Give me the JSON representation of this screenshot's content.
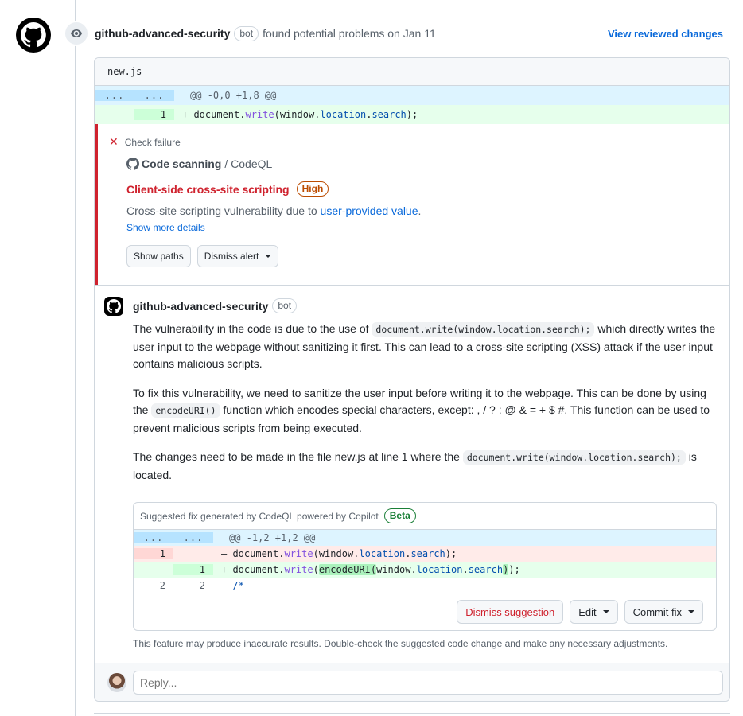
{
  "review": {
    "author": "github-advanced-security",
    "bot_label": "bot",
    "action_text": "found potential problems on Jan 11",
    "view_link": "View reviewed changes"
  },
  "file": {
    "name": "new.js",
    "hunk_header": "@@ -0,0 +1,8 @@",
    "dots": "...",
    "lines": [
      {
        "type": "add",
        "old": "",
        "new": "1",
        "sign": "+",
        "parts": [
          {
            "t": "document.",
            "c": ""
          },
          {
            "t": "write",
            "c": "fn"
          },
          {
            "t": "(window.",
            "c": ""
          },
          {
            "t": "location",
            "c": "prop"
          },
          {
            "t": ".",
            "c": ""
          },
          {
            "t": "search",
            "c": "prop"
          },
          {
            "t": ");",
            "c": ""
          }
        ]
      }
    ]
  },
  "alert": {
    "check_status": "Check failure",
    "scanner_name": "Code scanning",
    "scanner_tool": "/ CodeQL",
    "title": "Client-side cross-site scripting",
    "severity": "High",
    "description_prefix": "Cross-site scripting vulnerability due to ",
    "description_link": "user-provided value",
    "description_suffix": ".",
    "show_more": "Show more details",
    "show_paths_button": "Show paths",
    "dismiss_alert_button": "Dismiss alert"
  },
  "comment": {
    "author": "github-advanced-security",
    "bot_label": "bot",
    "p1_a": "The vulnerability in the code is due to the use of ",
    "p1_code": "document.write(window.location.search);",
    "p1_b": " which directly writes the user input to the webpage without sanitizing it first. This can lead to a cross-site scripting (XSS) attack if the user input contains malicious scripts.",
    "p2_a": "To fix this vulnerability, we need to sanitize the user input before writing it to the webpage. This can be done by using the ",
    "p2_code": "encodeURI()",
    "p2_b": " function which encodes special characters, except: , / ? : @ & = + $ #. This function can be used to prevent malicious scripts from being executed.",
    "p3_a": "The changes need to be made in the file new.js at line 1 where the ",
    "p3_code": "document.write(window.location.search);",
    "p3_b": " is located."
  },
  "suggestion": {
    "header": "Suggested fix generated by CodeQL powered by Copilot",
    "badge": "Beta",
    "hunk_header": "@@ -1,2 +1,2 @@",
    "dots": "...",
    "lines": [
      {
        "type": "del",
        "old": "1",
        "new": "",
        "sign": "–",
        "parts": [
          {
            "t": "document.",
            "c": ""
          },
          {
            "t": "write",
            "c": "fn"
          },
          {
            "t": "(window.",
            "c": ""
          },
          {
            "t": "location",
            "c": "prop"
          },
          {
            "t": ".",
            "c": ""
          },
          {
            "t": "search",
            "c": "prop"
          },
          {
            "t": ");",
            "c": ""
          }
        ]
      },
      {
        "type": "add",
        "old": "",
        "new": "1",
        "sign": "+",
        "parts": [
          {
            "t": "document.",
            "c": ""
          },
          {
            "t": "write",
            "c": "fn"
          },
          {
            "t": "(",
            "c": ""
          },
          {
            "t": "encodeURI(",
            "c": "hl"
          },
          {
            "t": "window.",
            "c": ""
          },
          {
            "t": "location",
            "c": "prop"
          },
          {
            "t": ".",
            "c": ""
          },
          {
            "t": "search",
            "c": "prop"
          },
          {
            "t": ")",
            "c": "hl"
          },
          {
            "t": ");",
            "c": ""
          }
        ]
      },
      {
        "type": "ctx",
        "old": "2",
        "new": "2",
        "sign": " ",
        "parts": [
          {
            "t": "/*",
            "c": "comment"
          }
        ]
      }
    ],
    "dismiss_button": "Dismiss suggestion",
    "edit_button": "Edit",
    "commit_button": "Commit fix"
  },
  "disclaimer": "This feature may produce inaccurate results. Double-check the suggested code change and make any necessary adjustments.",
  "reply": {
    "placeholder": "Reply..."
  }
}
